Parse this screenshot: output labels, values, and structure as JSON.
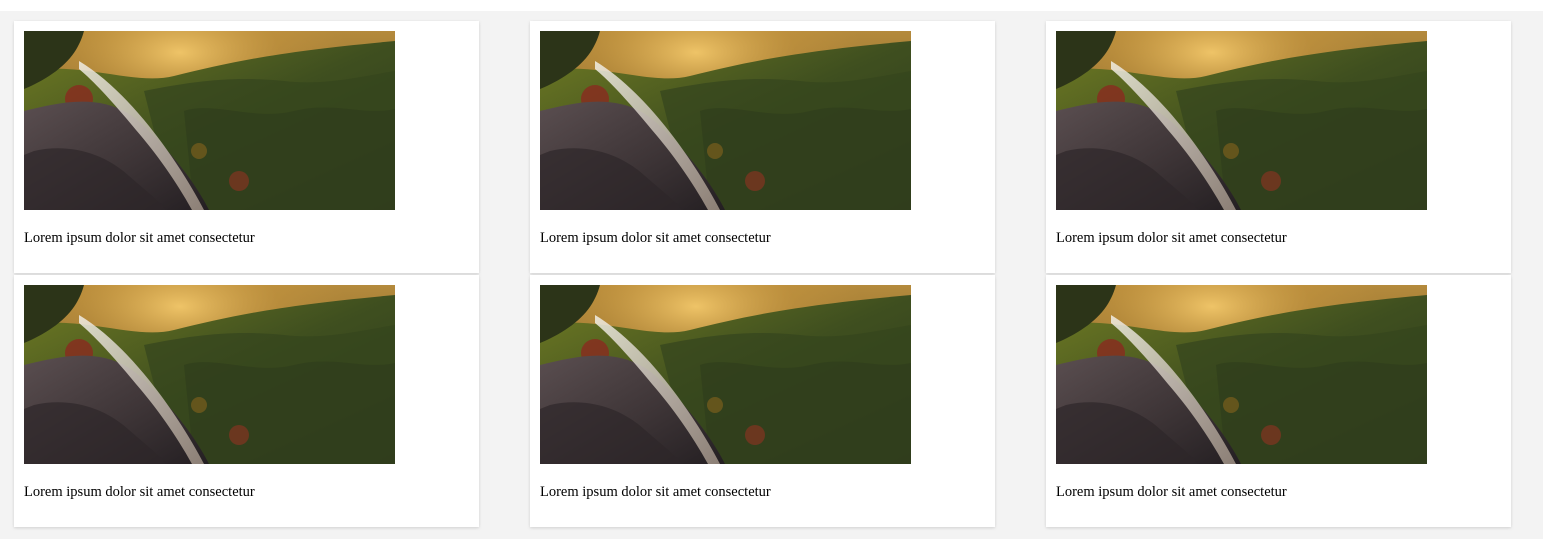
{
  "gallery": {
    "cards": [
      {
        "caption": "Lorem ipsum dolor sit amet consectetur",
        "image": "landscape-forest-cliff"
      },
      {
        "caption": "Lorem ipsum dolor sit amet consectetur",
        "image": "landscape-forest-cliff"
      },
      {
        "caption": "Lorem ipsum dolor sit amet consectetur",
        "image": "landscape-forest-cliff"
      },
      {
        "caption": "Lorem ipsum dolor sit amet consectetur",
        "image": "landscape-forest-cliff"
      },
      {
        "caption": "Lorem ipsum dolor sit amet consectetur",
        "image": "landscape-forest-cliff"
      },
      {
        "caption": "Lorem ipsum dolor sit amet consectetur",
        "image": "landscape-forest-cliff"
      }
    ]
  },
  "colors": {
    "page_background": "#f3f3f3",
    "card_background": "#ffffff",
    "text": "#000000"
  }
}
